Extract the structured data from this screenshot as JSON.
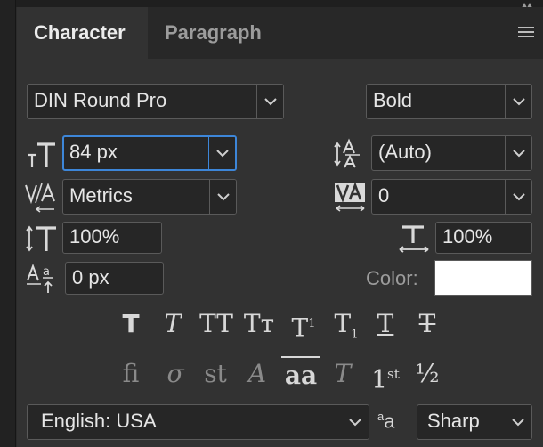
{
  "panel": {
    "tabs": [
      {
        "label": "Character"
      },
      {
        "label": "Paragraph"
      }
    ]
  },
  "character": {
    "font_family": "DIN Round Pro",
    "font_style": "Bold",
    "font_size": "84 px",
    "leading": "(Auto)",
    "kerning": "Metrics",
    "tracking": "0",
    "vertical_scale": "100%",
    "horizontal_scale": "100%",
    "baseline_shift": "0 px",
    "color_label": "Color:",
    "color_value": "#ffffff",
    "language": "English: USA",
    "antialias": "Sharp"
  },
  "icons": {
    "font_size": "font-size-icon",
    "leading": "leading-icon",
    "kerning": "kerning-icon",
    "tracking": "tracking-icon",
    "vertical_scale": "vertical-scale-icon",
    "horizontal_scale": "horizontal-scale-icon",
    "baseline_shift": "baseline-shift-icon",
    "antialias": "antialias-icon",
    "panel_menu": "hamburger-menu-icon"
  },
  "style_buttons": [
    {
      "name": "faux-bold",
      "glyph": "T"
    },
    {
      "name": "faux-italic",
      "glyph": "T"
    },
    {
      "name": "all-caps",
      "glyph": "TT"
    },
    {
      "name": "small-caps",
      "glyph": "Tт"
    },
    {
      "name": "superscript",
      "glyph": "T",
      "sup": "1"
    },
    {
      "name": "subscript",
      "glyph": "T",
      "sub": "1"
    },
    {
      "name": "underline",
      "glyph": "T"
    },
    {
      "name": "strikethrough",
      "glyph": "T"
    }
  ],
  "opentype_buttons": [
    {
      "name": "standard-ligatures",
      "glyph": "fi"
    },
    {
      "name": "contextual-alternates",
      "glyph": "σ"
    },
    {
      "name": "discretionary-ligatures",
      "glyph": "st"
    },
    {
      "name": "swash",
      "glyph": "A"
    },
    {
      "name": "stylistic-alternates",
      "glyph": "aa"
    },
    {
      "name": "titling-alternates",
      "glyph": "T"
    },
    {
      "name": "ordinals",
      "glyph": "1",
      "sup": "st"
    },
    {
      "name": "fractions",
      "glyph": "½"
    }
  ]
}
